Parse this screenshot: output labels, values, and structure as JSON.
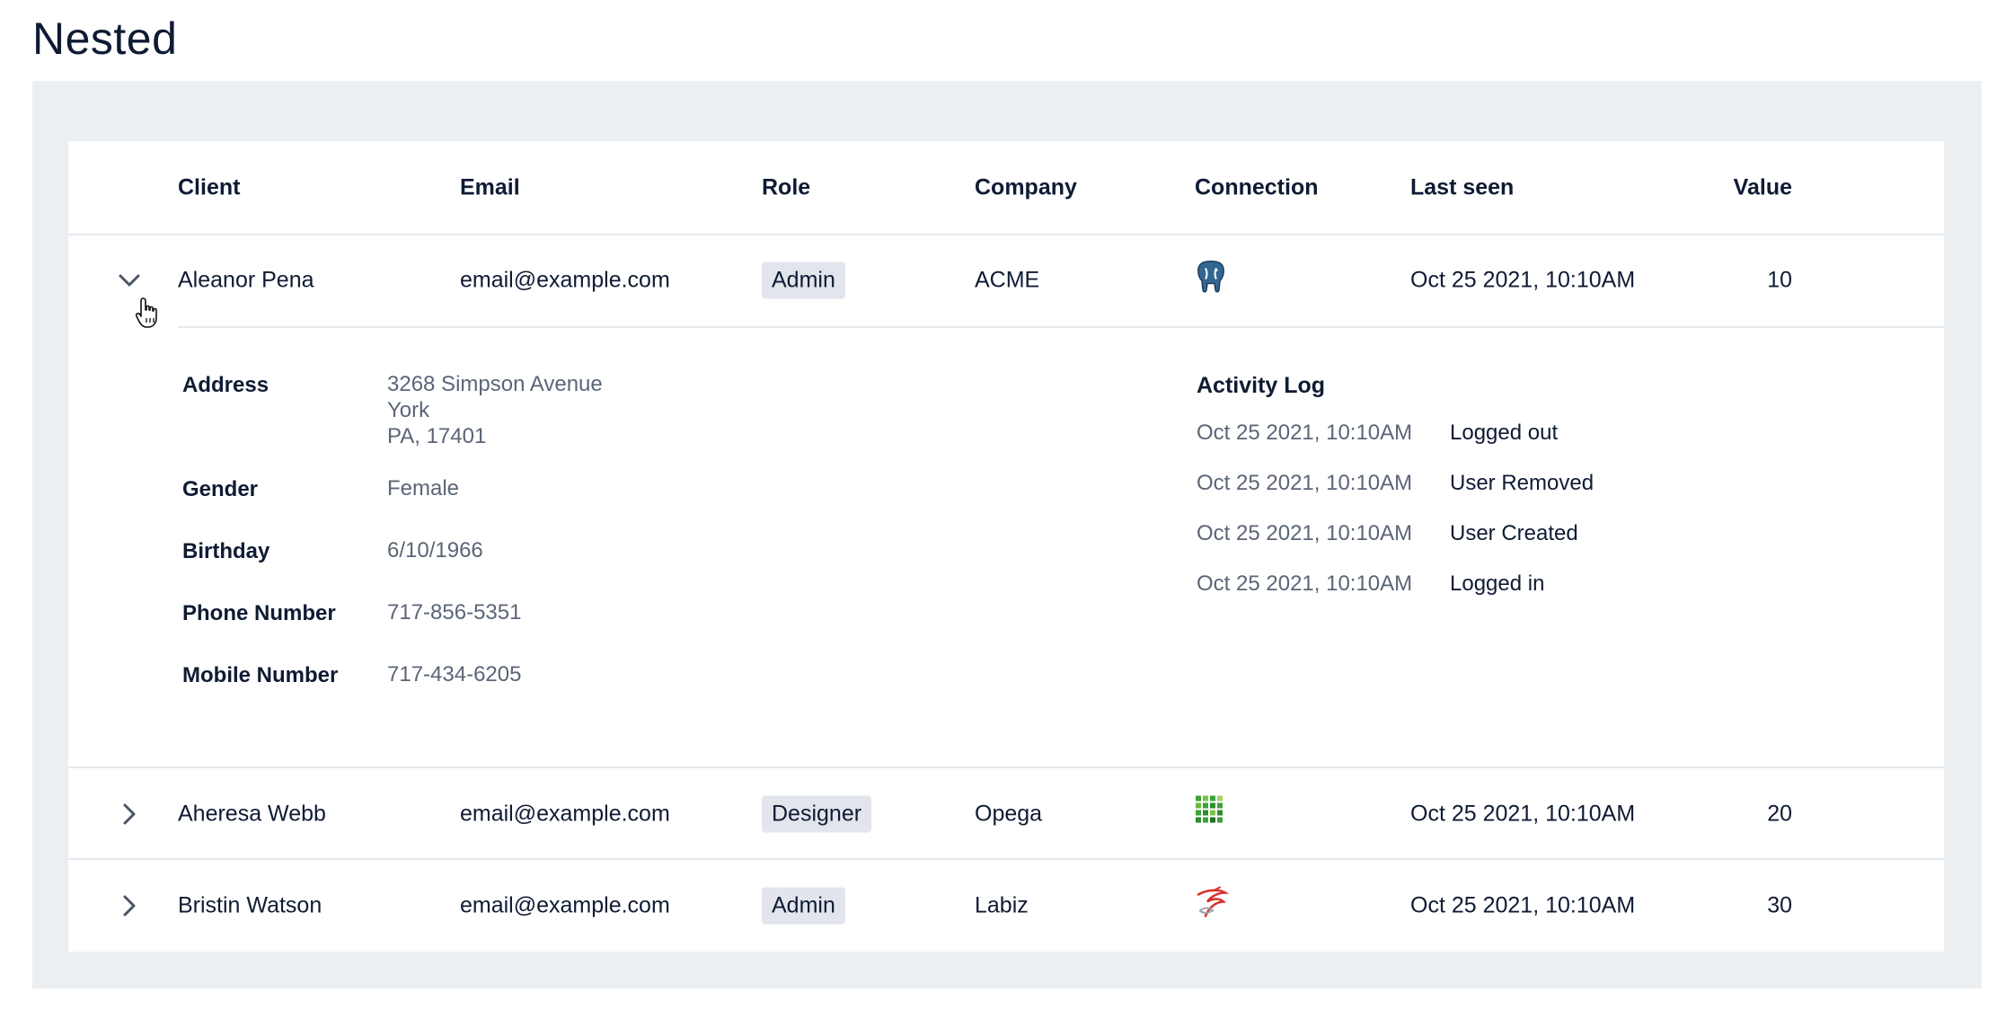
{
  "page": {
    "title": "Nested"
  },
  "table": {
    "columns": [
      "Client",
      "Email",
      "Role",
      "Company",
      "Connection",
      "Last seen",
      "Value"
    ],
    "rows": [
      {
        "client": "Aleanor Pena",
        "email": "email@example.com",
        "role": "Admin",
        "company": "ACME",
        "connection_icon": "postgresql-elephant-icon",
        "last_seen": "Oct 25  2021, 10:10AM",
        "value": "10",
        "expanded": true
      },
      {
        "client": "Aheresa Webb",
        "email": "email@example.com",
        "role": "Designer",
        "company": "Opega",
        "connection_icon": "green-grid-db-icon",
        "last_seen": "Oct 25  2021, 10:10AM",
        "value": "20",
        "expanded": false
      },
      {
        "client": "Bristin Watson",
        "email": "email@example.com",
        "role": "Admin",
        "company": "Labiz",
        "connection_icon": "sql-server-icon",
        "last_seen": "Oct 25  2021, 10:10AM",
        "value": "30",
        "expanded": false
      }
    ]
  },
  "details": {
    "address_label": "Address",
    "address_lines": [
      "3268 Simpson Avenue",
      "York",
      "PA, 17401"
    ],
    "gender_label": "Gender",
    "gender": "Female",
    "birthday_label": "Birthday",
    "birthday": "6/10/1966",
    "phone_label": "Phone Number",
    "phone": "717-856-5351",
    "mobile_label": "Mobile Number",
    "mobile": "717-434-6205",
    "activity_title": "Activity Log",
    "activity": [
      {
        "time": "Oct 25  2021, 10:10AM",
        "action": "Logged out"
      },
      {
        "time": "Oct 25  2021, 10:10AM",
        "action": "User Removed"
      },
      {
        "time": "Oct 25  2021, 10:10AM",
        "action": "User Created"
      },
      {
        "time": "Oct 25  2021, 10:10AM",
        "action": "Logged in"
      }
    ]
  },
  "colors": {
    "frame_bg": "#eceff2",
    "badge_bg": "#e2e5ec",
    "text": "#0f1b33",
    "muted": "#5b6577",
    "postgres_blue": "#336791",
    "grid_green": "#3aa33a",
    "sqlserver_red": "#d9302b"
  }
}
